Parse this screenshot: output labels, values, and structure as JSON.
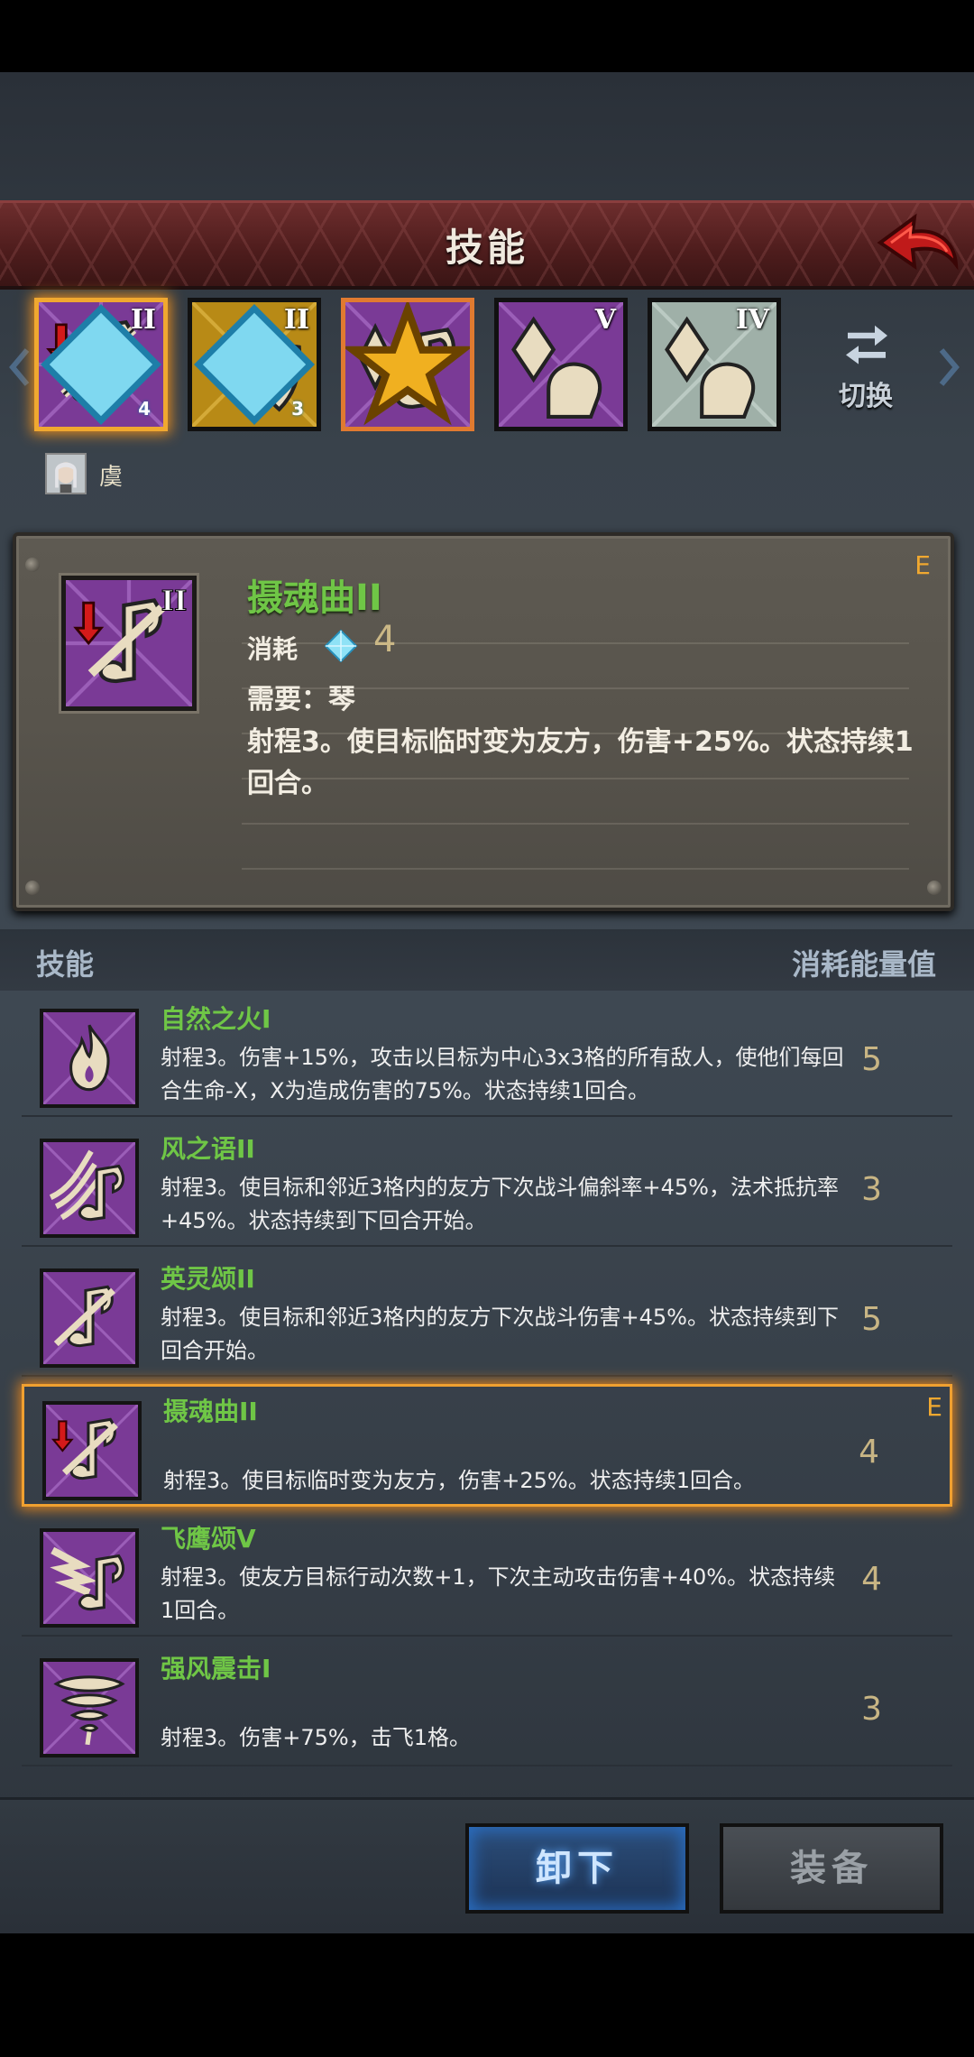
{
  "header": {
    "title": "技能"
  },
  "slots": [
    {
      "roman": "II",
      "gem": "4"
    },
    {
      "roman": "II",
      "gem": "3"
    },
    {
      "roman": ""
    },
    {
      "roman": "V"
    },
    {
      "roman": "IV"
    }
  ],
  "switch_label": "切换",
  "character": {
    "name": "虞"
  },
  "detail": {
    "name": "摄魂曲II",
    "cost_label": "消耗",
    "cost_value": "4",
    "requirement": "需要：琴",
    "description": "射程3。使目标临时变为友方，伤害+25%。状态持续1回合。",
    "equipped_mark": "E"
  },
  "list_header": {
    "left": "技能",
    "right": "消耗能量值"
  },
  "skills": [
    {
      "name": "自然之火I",
      "desc": "射程3。伤害+15%，攻击以目标为中心3x3格的所有敌人，使他们每回合生命-X，X为造成伤害的75%。状态持续1回合。",
      "cost": "5"
    },
    {
      "name": "风之语II",
      "desc": "射程3。使目标和邻近3格内的友方下次战斗偏斜率+45%，法术抵抗率+45%。状态持续到下回合开始。",
      "cost": "3"
    },
    {
      "name": "英灵颂II",
      "desc": "射程3。使目标和邻近3格内的友方下次战斗伤害+45%。状态持续到下回合开始。",
      "cost": "5"
    },
    {
      "name": "摄魂曲II",
      "desc": "射程3。使目标临时变为友方，伤害+25%。状态持续1回合。",
      "cost": "4",
      "equipped": "E"
    },
    {
      "name": "飞鹰颂V",
      "desc": "射程3。使友方目标行动次数+1，下次主动攻击伤害+40%。状态持续1回合。",
      "cost": "4"
    },
    {
      "name": "强风震击I",
      "desc": "射程3。伤害+75%，击飞1格。",
      "cost": "3"
    }
  ],
  "buttons": {
    "unequip": "卸下",
    "equip": "装备"
  }
}
